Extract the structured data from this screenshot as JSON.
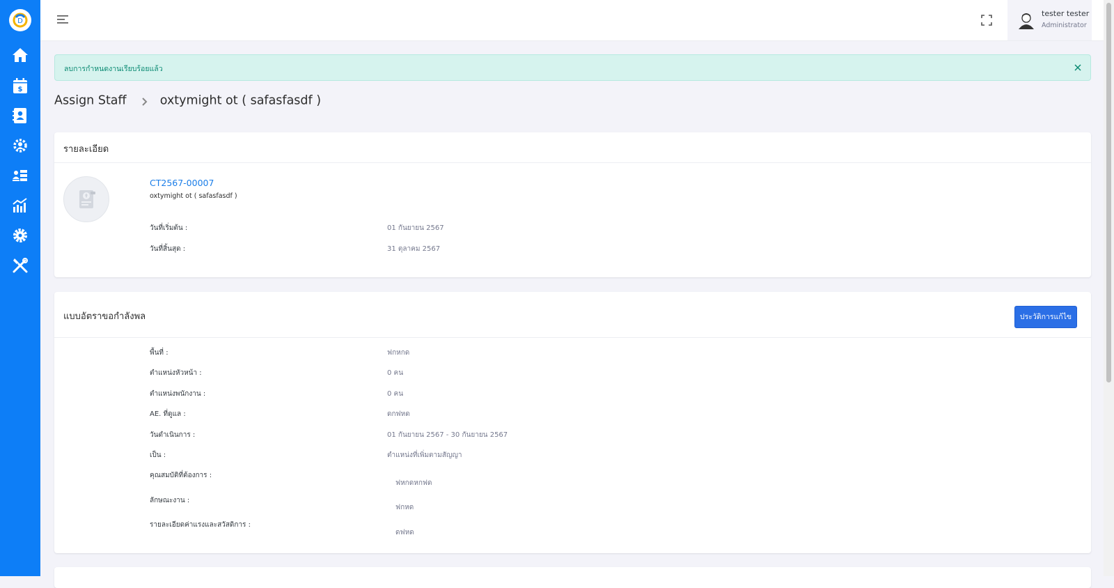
{
  "topbar": {
    "user_name": "tester tester",
    "user_role": "Administrator"
  },
  "sidebar": {
    "items": [
      {
        "icon": "home-icon"
      },
      {
        "icon": "calendar-dollar-icon"
      },
      {
        "icon": "contact-book-icon"
      },
      {
        "icon": "team-gear-icon"
      },
      {
        "icon": "staff-list-icon"
      },
      {
        "icon": "chart-icon"
      },
      {
        "icon": "settings-icon"
      },
      {
        "icon": "tools-icon"
      }
    ]
  },
  "alert": {
    "message": "ลบการกำหนดงานเรียบร้อยแล้ว"
  },
  "breadcrumb": {
    "root": "Assign Staff",
    "current": "oxtymight ot ( safasfasdf )"
  },
  "details": {
    "title": "รายละเอียด",
    "contract_code": "CT2567-00007",
    "contract_name": "oxtymight ot ( safasfasdf )",
    "start_label": "วันที่เริ่มต้น :",
    "start_value": "01 กันยายน 2567",
    "end_label": "วันที่สิ้นสุด :",
    "end_value": "31 ตุลาคม 2567"
  },
  "manpower": {
    "title": "แบบอัตราขอกำลังพล",
    "history_button": "ประวัติการแก้ไข",
    "rows": [
      {
        "label": "พื้นที่ :",
        "value": "ฟกหกด"
      },
      {
        "label": "ตำแหน่งหัวหน้า :",
        "value": "0 คน"
      },
      {
        "label": "ตำแหน่งพนักงาน :",
        "value": "0 คน"
      },
      {
        "label": "AE. ที่ดูแล :",
        "value": "ดกฟหด"
      },
      {
        "label": "วันดำเนินการ :",
        "value": "01 กันยายน 2567 - 30 กันยายน 2567"
      },
      {
        "label": "เป็น :",
        "value": "ตำแหน่งที่เพิ่มตามสัญญา"
      },
      {
        "label": "คุณสมบัติที่ต้องการ :",
        "value": "ฟหกดหกฟด"
      },
      {
        "label": "ลักษณะงาน :",
        "value": "ฟกหด"
      },
      {
        "label": "รายละเอียดค่าแรงและสวัสดิการ :",
        "value": "ดฟหด"
      }
    ]
  },
  "colors": {
    "sidebar": "#0d7ef7",
    "accent": "#2b6fe6",
    "alert_bg": "#d6f3ee",
    "alert_text": "#0a8a72",
    "link": "#1a7de8"
  }
}
